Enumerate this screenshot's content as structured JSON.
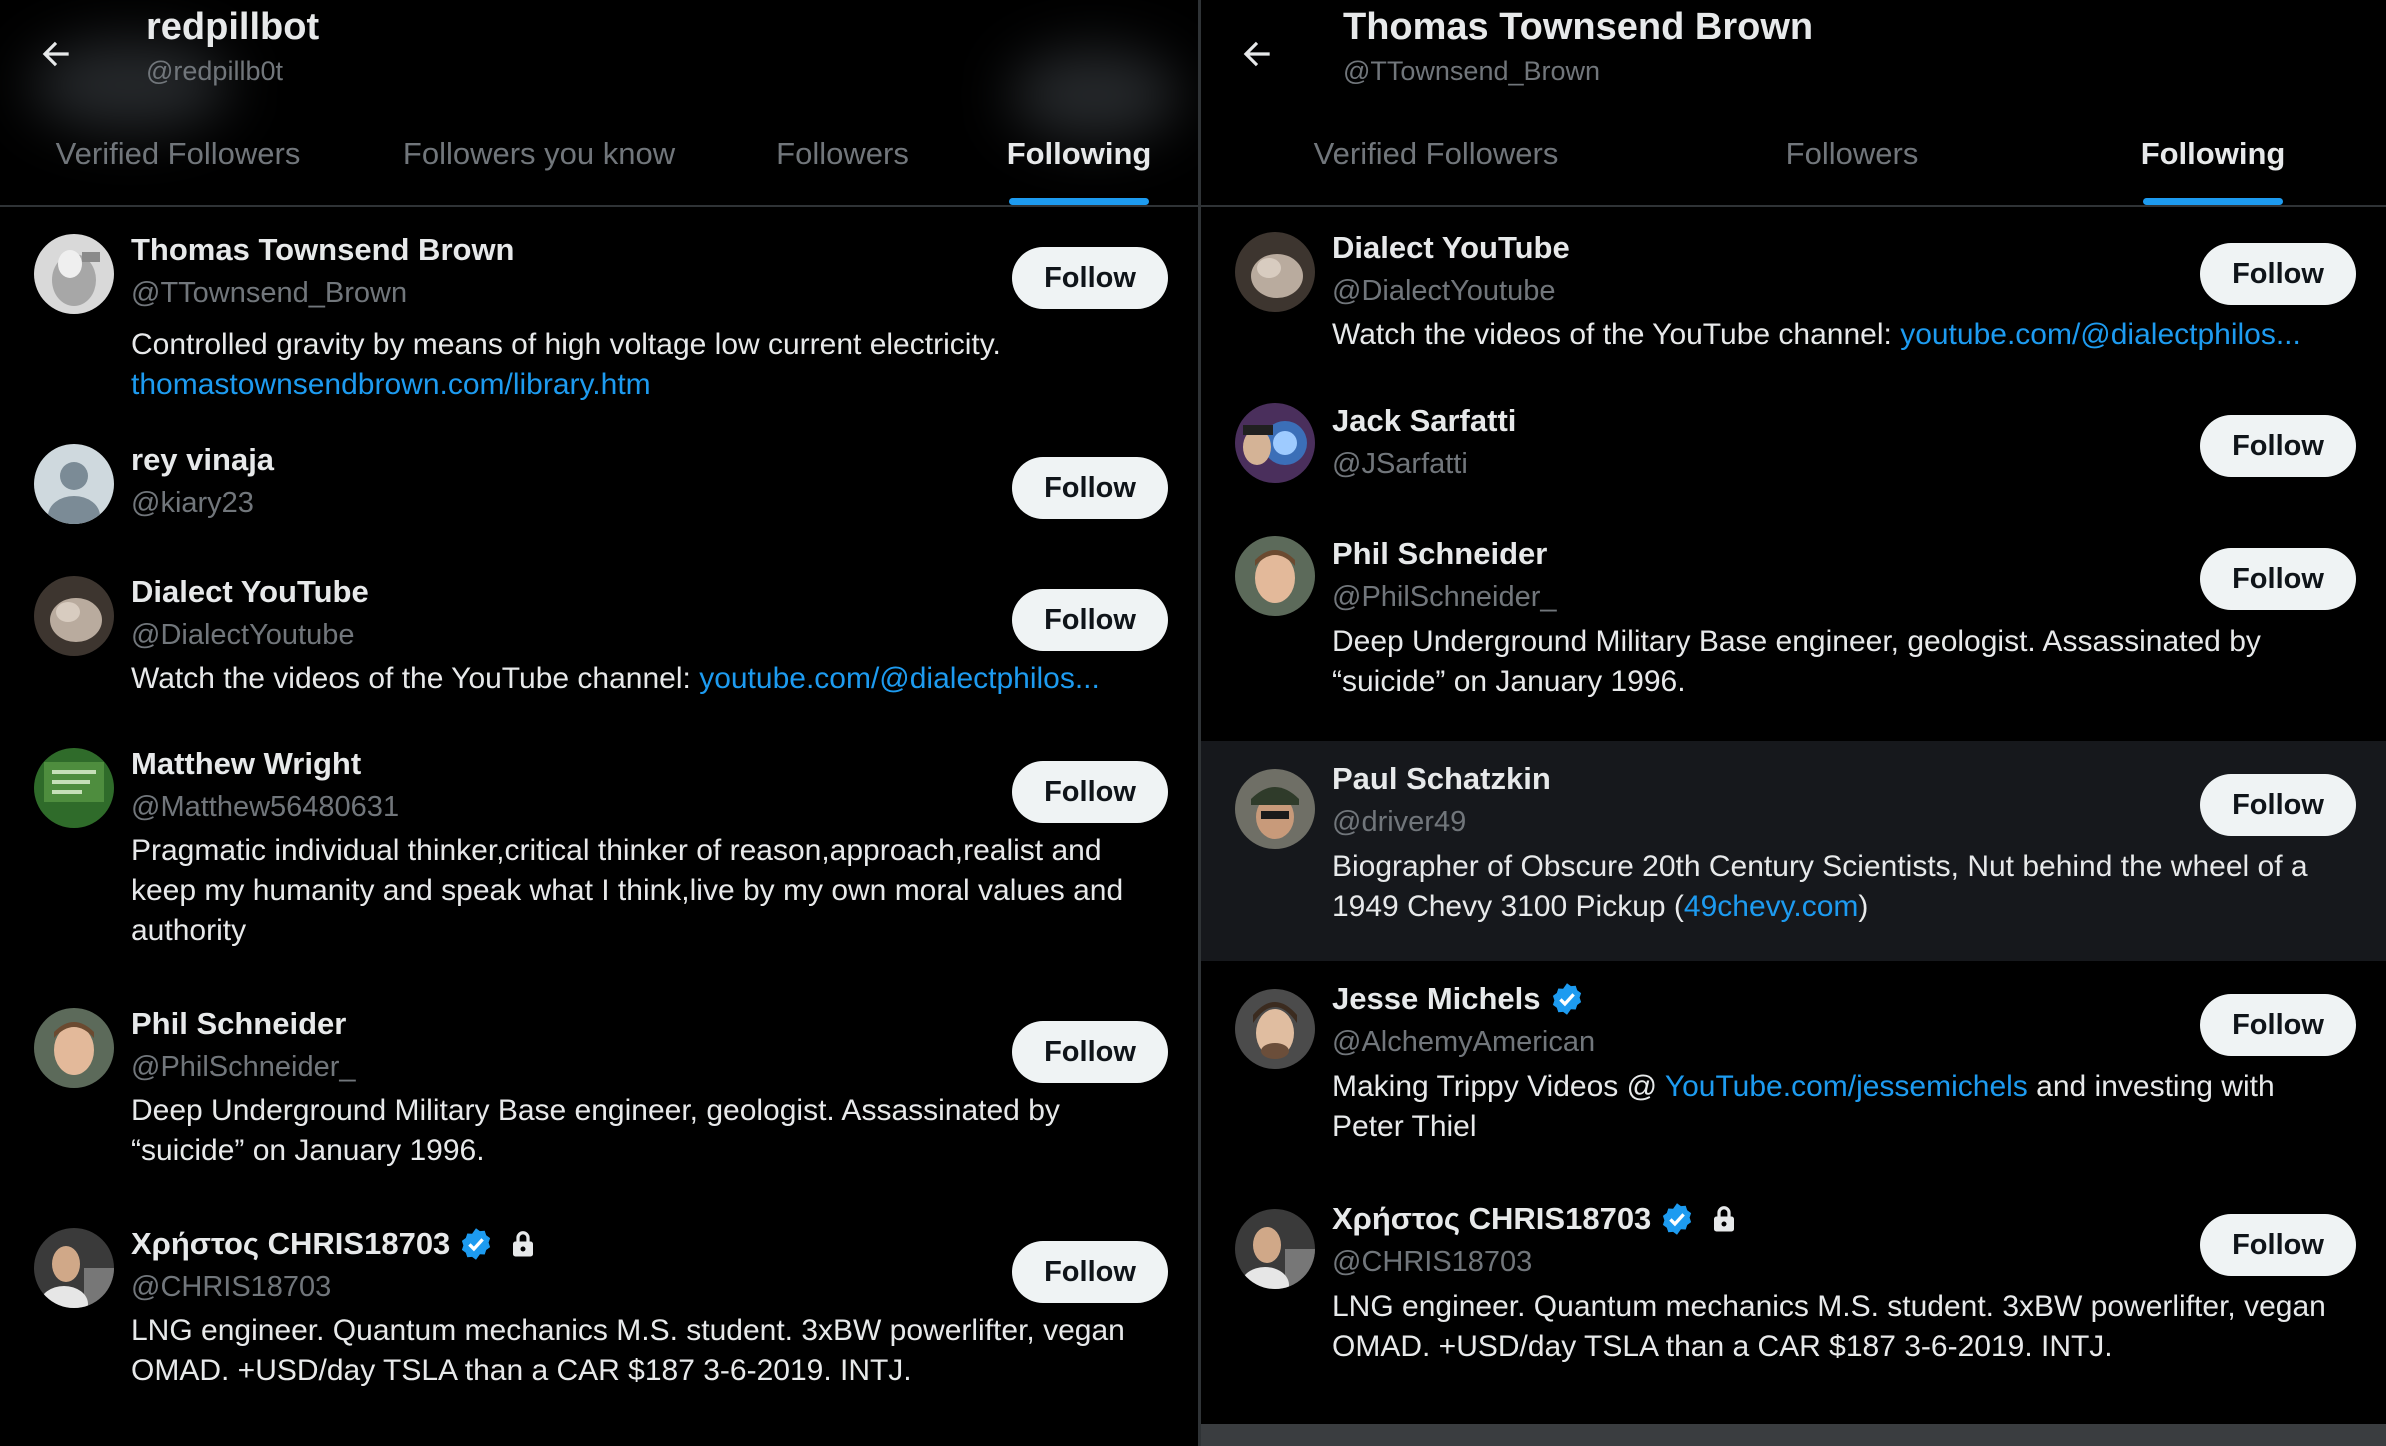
{
  "left": {
    "title": "redpillbot",
    "handle": "@redpillb0t",
    "tabs": [
      "Verified Followers",
      "Followers you know",
      "Followers",
      "Following"
    ],
    "active_tab": "Following",
    "users": [
      {
        "name": "Thomas Townsend Brown",
        "handle": "@TTownsend_Brown",
        "bio": "Controlled gravity by means of high voltage low current electricity.",
        "link": "thomastownsendbrown.com/library.htm",
        "follow": "Follow"
      },
      {
        "name": "rey vinaja",
        "handle": "@kiary23",
        "follow": "Follow"
      },
      {
        "name": "Dialect YouTube",
        "handle": "@DialectYoutube",
        "bio": "Watch the videos of the YouTube channel:",
        "link": "youtube.com/@dialectphilos...",
        "follow": "Follow"
      },
      {
        "name": "Matthew Wright",
        "handle": "@Matthew56480631",
        "bio": "Pragmatic individual thinker,critical thinker of reason,approach,realist and keep my humanity and speak what I think,live by my own moral values and authority",
        "follow": "Follow"
      },
      {
        "name": "Phil Schneider",
        "handle": "@PhilSchneider_",
        "bio": "Deep Underground Military Base engineer, geologist. Assassinated by “suicide” on January 1996.",
        "follow": "Follow"
      },
      {
        "name": "Χρήστος CHRIS18703",
        "handle": "@CHRIS18703",
        "bio": "LNG engineer. Quantum mechanics M.S. student. 3xBW powerlifter, vegan OMAD. +USD/day TSLA than a CAR $187 3-6-2019. INTJ.",
        "follow": "Follow"
      }
    ]
  },
  "right": {
    "title": "Thomas Townsend Brown",
    "handle": "@TTownsend_Brown",
    "tabs": [
      "Verified Followers",
      "Followers",
      "Following"
    ],
    "active_tab": "Following",
    "users": [
      {
        "name": "Dialect YouTube",
        "handle": "@DialectYoutube",
        "bio": "Watch the videos of the YouTube channel:",
        "link": "youtube.com/@dialectphilos...",
        "follow": "Follow"
      },
      {
        "name": "Jack Sarfatti",
        "handle": "@JSarfatti",
        "follow": "Follow"
      },
      {
        "name": "Phil Schneider",
        "handle": "@PhilSchneider_",
        "bio": "Deep Underground Military Base engineer, geologist. Assassinated by “suicide” on January 1996.",
        "follow": "Follow"
      },
      {
        "name": "Paul Schatzkin",
        "handle": "@driver49",
        "bio_pre": "Biographer of Obscure 20th Century Scientists, Nut behind the wheel of a 1949 Chevy 3100 Pickup (",
        "link": "49chevy.com",
        "bio_post": ")",
        "follow": "Follow"
      },
      {
        "name": "Jesse Michels",
        "handle": "@AlchemyAmerican",
        "bio_pre": "Making Trippy Videos @ ",
        "link": "YouTube.com/jessemichels",
        "bio_post": " and investing with Peter Thiel",
        "follow": "Follow"
      },
      {
        "name": "Χρήστος CHRIS18703",
        "handle": "@CHRIS18703",
        "bio": "LNG engineer. Quantum mechanics M.S. student. 3xBW powerlifter, vegan OMAD. +USD/day TSLA than a CAR $187 3-6-2019. INTJ.",
        "follow": "Follow"
      }
    ]
  },
  "colors": {
    "accent": "#1d9bf0",
    "background": "#000000",
    "text": "#e7e9ea",
    "muted": "#71767b",
    "button": "#eff3f4"
  }
}
